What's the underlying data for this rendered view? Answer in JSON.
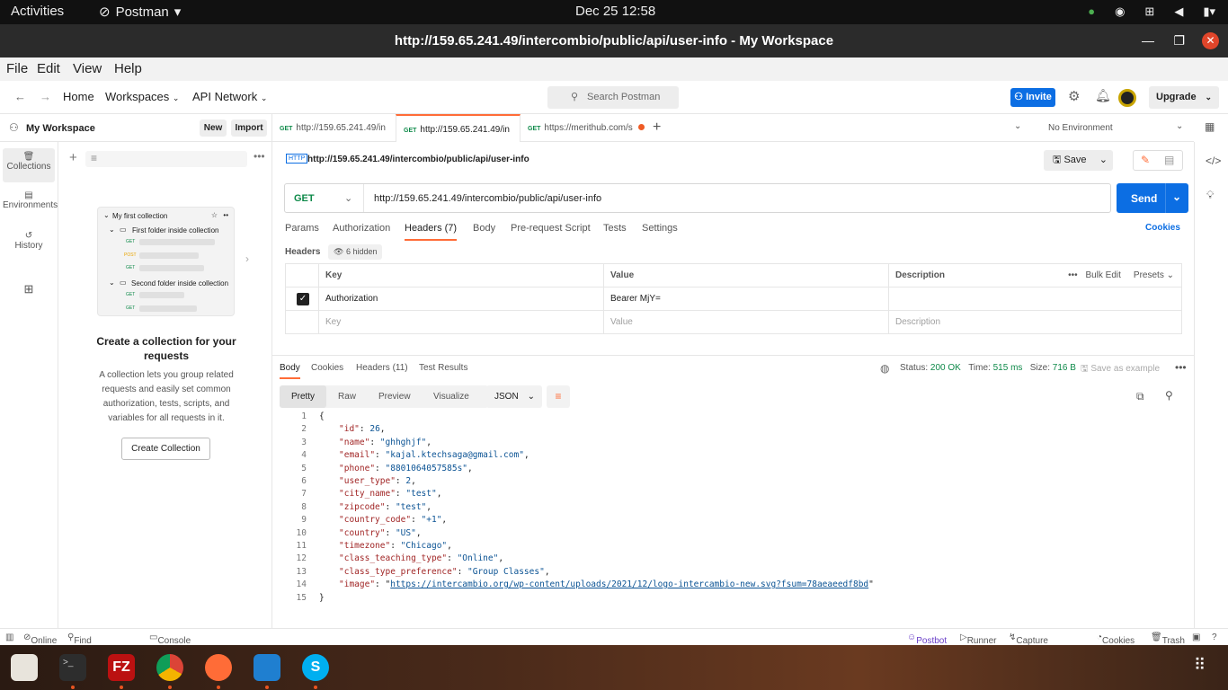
{
  "system": {
    "activities": "Activities",
    "app": "Postman",
    "clock": "Dec 25  12:58"
  },
  "window": {
    "title": "http://159.65.241.49/intercombio/public/api/user-info - My Workspace"
  },
  "menu": [
    "File",
    "Edit",
    "View",
    "Help"
  ],
  "header": {
    "home": "Home",
    "workspaces": "Workspaces",
    "api_network": "API Network",
    "search_placeholder": "Search Postman",
    "invite": "Invite",
    "upgrade": "Upgrade"
  },
  "workspace": {
    "name": "My Workspace",
    "new": "New",
    "import": "Import"
  },
  "rail": {
    "collections": "Collections",
    "environments": "Environments",
    "history": "History"
  },
  "sidebar": {
    "illus_collection": "My first collection",
    "illus_folder1": "First folder inside collection",
    "illus_folder2": "Second folder inside collection",
    "illus_get": "GET",
    "illus_post": "POST",
    "empty_title": "Create a collection for your requests",
    "empty_text": "A collection lets you group related requests and easily set common authorization, tests, scripts, and variables for all requests in it.",
    "create_button": "Create Collection"
  },
  "tabs": [
    {
      "method": "GET",
      "label": "http://159.65.241.49/in"
    },
    {
      "method": "GET",
      "label": "http://159.65.241.49/in"
    },
    {
      "method": "GET",
      "label": "https://merithub.com/s"
    }
  ],
  "environment": "No Environment",
  "request": {
    "title": "http://159.65.241.49/intercombio/public/api/user-info",
    "save": "Save",
    "method": "GET",
    "url": "http://159.65.241.49/intercombio/public/api/user-info",
    "send": "Send",
    "subtabs": [
      "Params",
      "Authorization",
      "Headers (7)",
      "Body",
      "Pre-request Script",
      "Tests",
      "Settings"
    ],
    "cookies": "Cookies",
    "headers_label": "Headers",
    "hidden": "6 hidden",
    "columns": [
      "Key",
      "Value",
      "Description"
    ],
    "bulk_edit": "Bulk Edit",
    "presets": "Presets",
    "row": {
      "key": "Authorization",
      "value": "Bearer MjY="
    },
    "placeholders": {
      "key": "Key",
      "value": "Value",
      "description": "Description"
    }
  },
  "response": {
    "tabs": [
      "Body",
      "Cookies",
      "Headers (11)",
      "Test Results"
    ],
    "status_label": "Status:",
    "status": "200 OK",
    "time_label": "Time:",
    "time": "515 ms",
    "size_label": "Size:",
    "size": "716 B",
    "save_example": "Save as example",
    "views": [
      "Pretty",
      "Raw",
      "Preview",
      "Visualize"
    ],
    "format": "JSON",
    "lines": [
      {
        "n": "1",
        "t": "{"
      },
      {
        "n": "2",
        "k": "\"id\"",
        "v": "26",
        "vt": "n"
      },
      {
        "n": "3",
        "k": "\"name\"",
        "v": "\"ghhghjf\"",
        "vt": "s"
      },
      {
        "n": "4",
        "k": "\"email\"",
        "v": "\"kajal.ktechsaga@gmail.com\"",
        "vt": "s"
      },
      {
        "n": "5",
        "k": "\"phone\"",
        "v": "\"8801064057585s\"",
        "vt": "s"
      },
      {
        "n": "6",
        "k": "\"user_type\"",
        "v": "2",
        "vt": "n"
      },
      {
        "n": "7",
        "k": "\"city_name\"",
        "v": "\"test\"",
        "vt": "s"
      },
      {
        "n": "8",
        "k": "\"zipcode\"",
        "v": "\"test\"",
        "vt": "s"
      },
      {
        "n": "9",
        "k": "\"country_code\"",
        "v": "\"+1\"",
        "vt": "s"
      },
      {
        "n": "10",
        "k": "\"country\"",
        "v": "\"US\"",
        "vt": "s"
      },
      {
        "n": "11",
        "k": "\"timezone\"",
        "v": "\"Chicago\"",
        "vt": "s"
      },
      {
        "n": "12",
        "k": "\"class_teaching_type\"",
        "v": "\"Online\"",
        "vt": "s"
      },
      {
        "n": "13",
        "k": "\"class_type_preference\"",
        "v": "\"Group Classes\"",
        "vt": "s"
      },
      {
        "n": "14",
        "k": "\"image\"",
        "v": "https://intercambio.org/wp-content/uploads/2021/12/logo-intercambio-new.svg?fsum=78aeaeedf8bd",
        "vt": "u",
        "last": true
      },
      {
        "n": "15",
        "t": "}"
      }
    ]
  },
  "status": {
    "online": "Online",
    "find": "Find and replace",
    "console": "Console",
    "postbot": "Postbot",
    "runner": "Runner",
    "capture": "Capture requests",
    "cookies": "Cookies",
    "trash": "Trash"
  },
  "colors": {
    "accent": "#ff6c37",
    "primary": "#0c6ee3",
    "ok": "#0f8a4a"
  }
}
